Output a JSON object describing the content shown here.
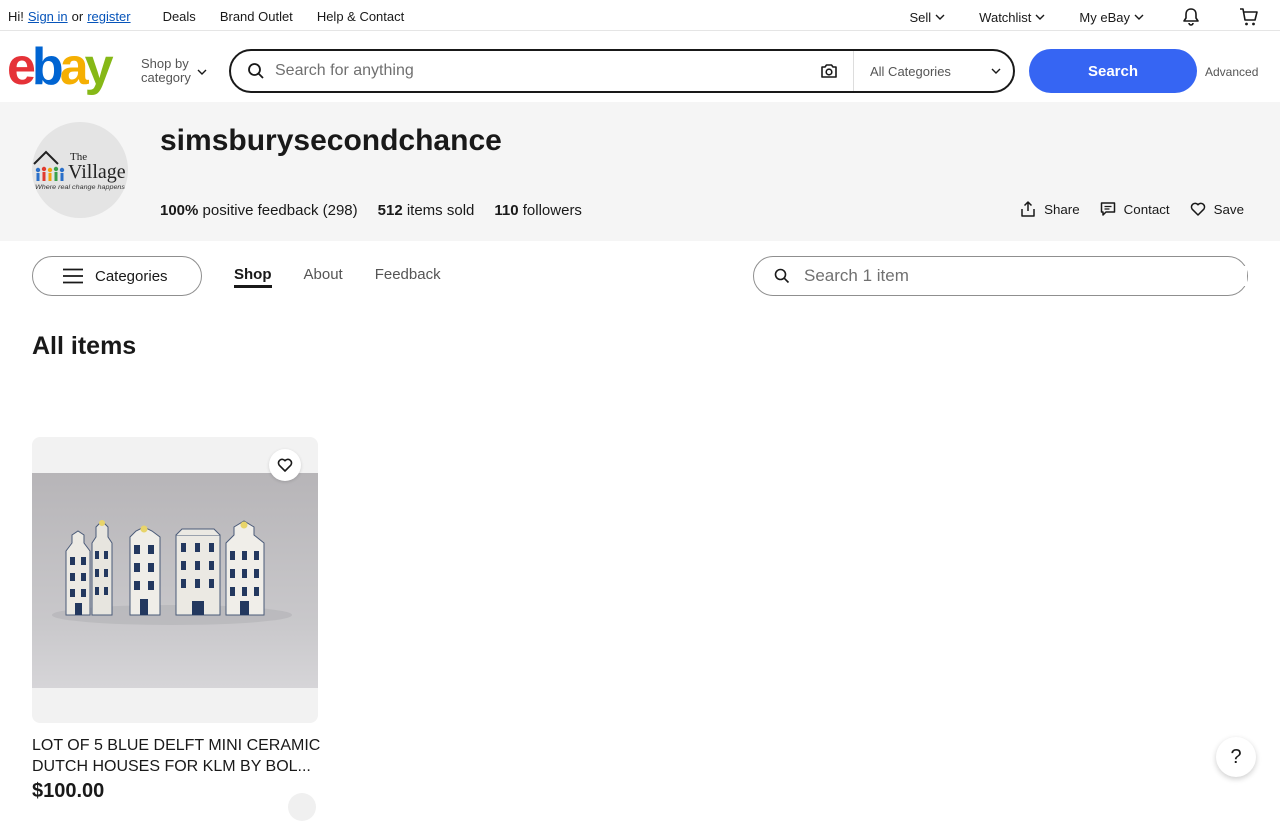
{
  "topbar": {
    "greeting": "Hi!",
    "sign_in": "Sign in",
    "or": "or",
    "register": "register",
    "nav": [
      "Deals",
      "Brand Outlet",
      "Help & Contact"
    ],
    "sell": "Sell",
    "watchlist": "Watchlist",
    "my_ebay": "My eBay"
  },
  "header": {
    "logo": [
      "e",
      "b",
      "a",
      "y"
    ],
    "shop_by_line1": "Shop by",
    "shop_by_line2": "category",
    "search_placeholder": "Search for anything",
    "category_select": "All Categories",
    "search_button": "Search",
    "advanced": "Advanced"
  },
  "store": {
    "name": "simsburysecondchance",
    "logo_text_top": "The",
    "logo_text_main": "Village",
    "logo_tagline": "Where real change happens",
    "feedback_pct": "100%",
    "feedback_text": "positive feedback (298)",
    "items_sold_num": "512",
    "items_sold_text": "items sold",
    "followers_num": "110",
    "followers_text": "followers",
    "share": "Share",
    "contact": "Contact",
    "save": "Save"
  },
  "storenav": {
    "categories": "Categories",
    "tabs": [
      "Shop",
      "About",
      "Feedback"
    ],
    "search_placeholder": "Search 1 item"
  },
  "main": {
    "heading": "All items",
    "item": {
      "title": "LOT OF 5 BLUE DELFT MINI CERAMIC DUTCH HOUSES FOR KLM BY BOL...",
      "price": "$100.00"
    }
  },
  "help_label": "?",
  "colors": {
    "accent": "#3665f3",
    "link": "#0654ba",
    "banner_bg": "#f5f5f5"
  }
}
